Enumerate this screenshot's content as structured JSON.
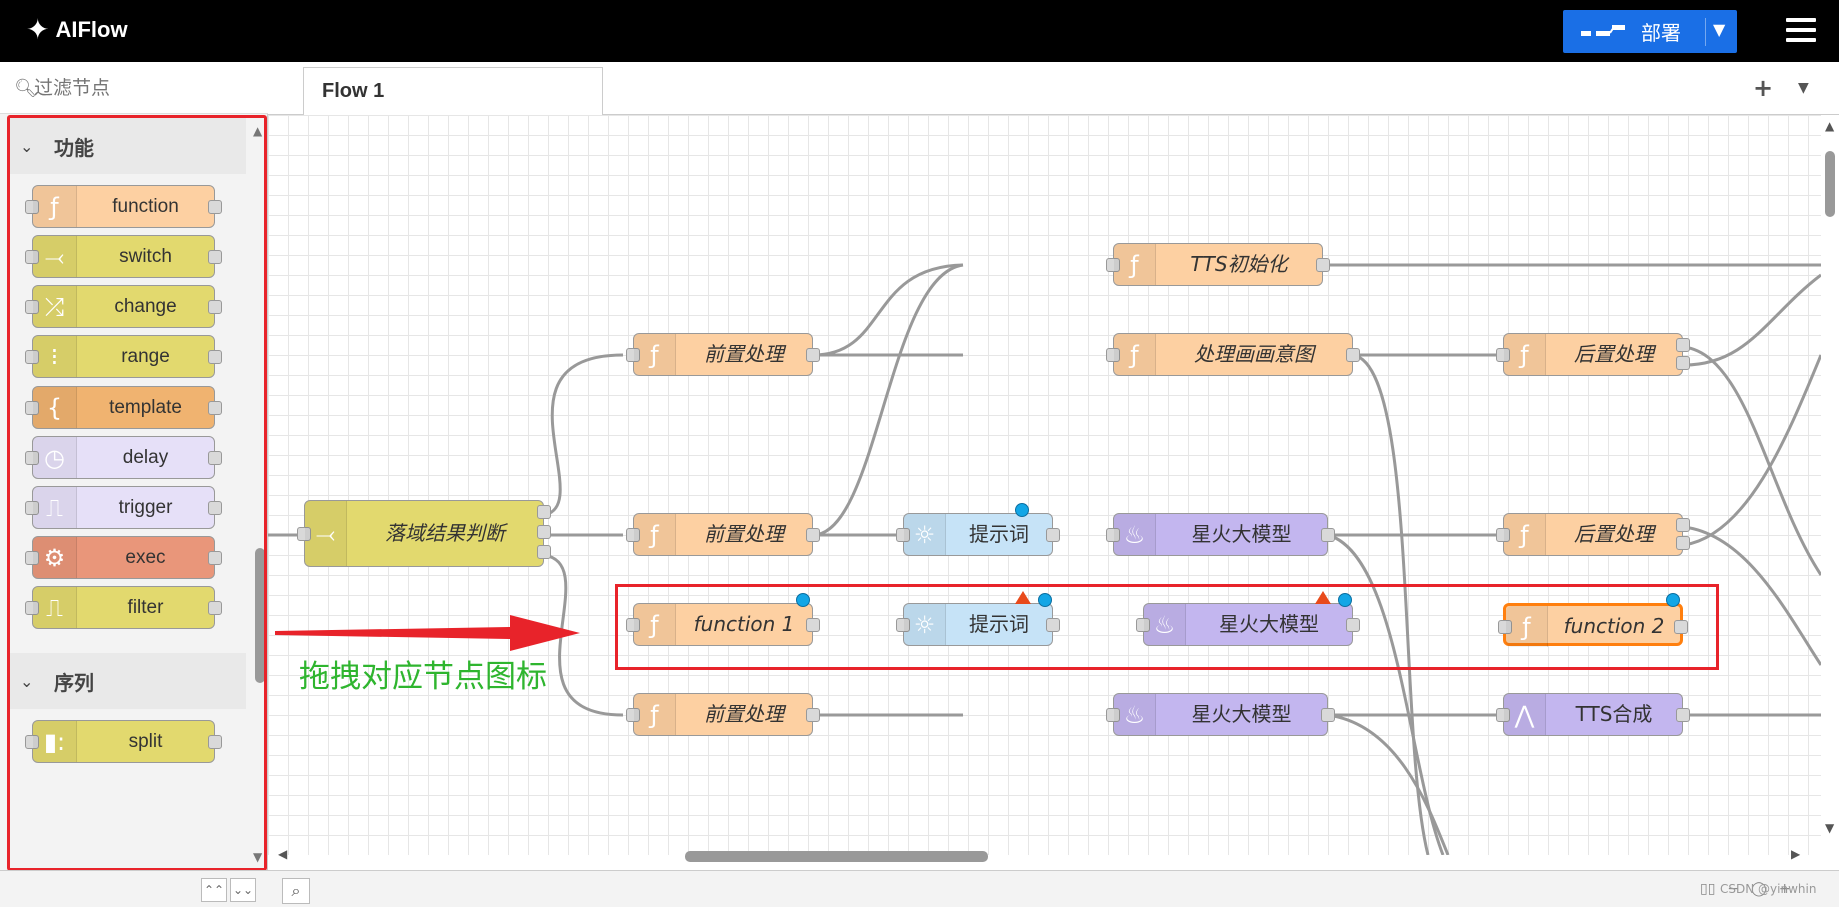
{
  "header": {
    "logo_text": "AIFlow",
    "deploy_label": "部署",
    "menu_icon": "hamburger-icon"
  },
  "palette": {
    "search_placeholder": "过滤节点",
    "categories": [
      {
        "label": "功能",
        "expanded": true
      },
      {
        "label": "序列",
        "expanded": true
      }
    ],
    "nodes": [
      {
        "label": "function",
        "color": "#fdd0a2",
        "icon": "function-icon",
        "glyph": "ƒ"
      },
      {
        "label": "switch",
        "color": "#e2d96e",
        "icon": "switch-icon",
        "glyph": "⤙"
      },
      {
        "label": "change",
        "color": "#e2d96e",
        "icon": "shuffle-icon",
        "glyph": "⤮"
      },
      {
        "label": "range",
        "color": "#e2d96e",
        "icon": "range-icon",
        "glyph": "⁝"
      },
      {
        "label": "template",
        "color": "#f0b370",
        "icon": "template-icon",
        "glyph": "{"
      },
      {
        "label": "delay",
        "color": "#e6e0f8",
        "icon": "timer-icon",
        "glyph": "◷"
      },
      {
        "label": "trigger",
        "color": "#e6e0f8",
        "icon": "trigger-icon",
        "glyph": "⎍"
      },
      {
        "label": "exec",
        "color": "#e9967a",
        "icon": "gear-icon",
        "glyph": "⚙"
      },
      {
        "label": "filter",
        "color": "#e2d96e",
        "icon": "filter-icon",
        "glyph": "⎍"
      },
      {
        "label": "split",
        "color": "#e2d96e",
        "icon": "split-icon",
        "glyph": "▮:"
      }
    ]
  },
  "workspace": {
    "tab_label": "Flow 1",
    "drag_hint": "拖拽对应节点图标",
    "nodes": [
      {
        "id": "tts-init",
        "label": "TTS初始化",
        "color": "#fdd0a2",
        "glyph": "ƒ",
        "icon": "function-icon"
      },
      {
        "id": "pre1",
        "label": "前置处理",
        "color": "#fdd0a2",
        "glyph": "ƒ",
        "icon": "function-icon"
      },
      {
        "id": "intent",
        "label": "处理画画意图",
        "color": "#fdd0a2",
        "glyph": "ƒ",
        "icon": "function-icon"
      },
      {
        "id": "post1",
        "label": "后置处理",
        "color": "#fdd0a2",
        "glyph": "ƒ",
        "icon": "function-icon"
      },
      {
        "id": "switch-main",
        "label": "落域结果判断",
        "color": "#e2d96e",
        "glyph": "⤙",
        "icon": "switch-icon"
      },
      {
        "id": "pre2",
        "label": "前置处理",
        "color": "#fdd0a2",
        "glyph": "ƒ",
        "icon": "function-icon"
      },
      {
        "id": "prompt1",
        "label": "提示词",
        "color": "#c6e3f7",
        "glyph": "☼",
        "icon": "bulb-icon",
        "plain": true
      },
      {
        "id": "llm1",
        "label": "星火大模型",
        "color": "#c3b6ef",
        "glyph": "♨",
        "icon": "fire-icon",
        "plain": true
      },
      {
        "id": "post2",
        "label": "后置处理",
        "color": "#fdd0a2",
        "glyph": "ƒ",
        "icon": "function-icon"
      },
      {
        "id": "fn1",
        "label": "function 1",
        "color": "#fdd0a2",
        "glyph": "ƒ",
        "icon": "function-icon"
      },
      {
        "id": "prompt2",
        "label": "提示词",
        "color": "#c6e3f7",
        "glyph": "☼",
        "icon": "bulb-icon",
        "plain": true
      },
      {
        "id": "llm2",
        "label": "星火大模型",
        "color": "#c3b6ef",
        "glyph": "♨",
        "icon": "fire-icon",
        "plain": true
      },
      {
        "id": "fn2",
        "label": "function 2",
        "color": "#fdd0a2",
        "glyph": "ƒ",
        "icon": "function-icon"
      },
      {
        "id": "pre3",
        "label": "前置处理",
        "color": "#fdd0a2",
        "glyph": "ƒ",
        "icon": "function-icon"
      },
      {
        "id": "llm3",
        "label": "星火大模型",
        "color": "#c3b6ef",
        "glyph": "♨",
        "icon": "fire-icon",
        "plain": true
      },
      {
        "id": "tts",
        "label": "TTS合成",
        "color": "#c3b6ef",
        "glyph": "⋀",
        "icon": "audio-icon",
        "plain": true
      }
    ]
  },
  "footer": {
    "watermark": "CSDN @yinwhin"
  },
  "colors": {
    "accent": "#1a6fe6",
    "highlight": "#e8232a",
    "hint_text": "#2fb52f",
    "status_blue": "#12a6e6",
    "warning": "#e84a1b"
  }
}
